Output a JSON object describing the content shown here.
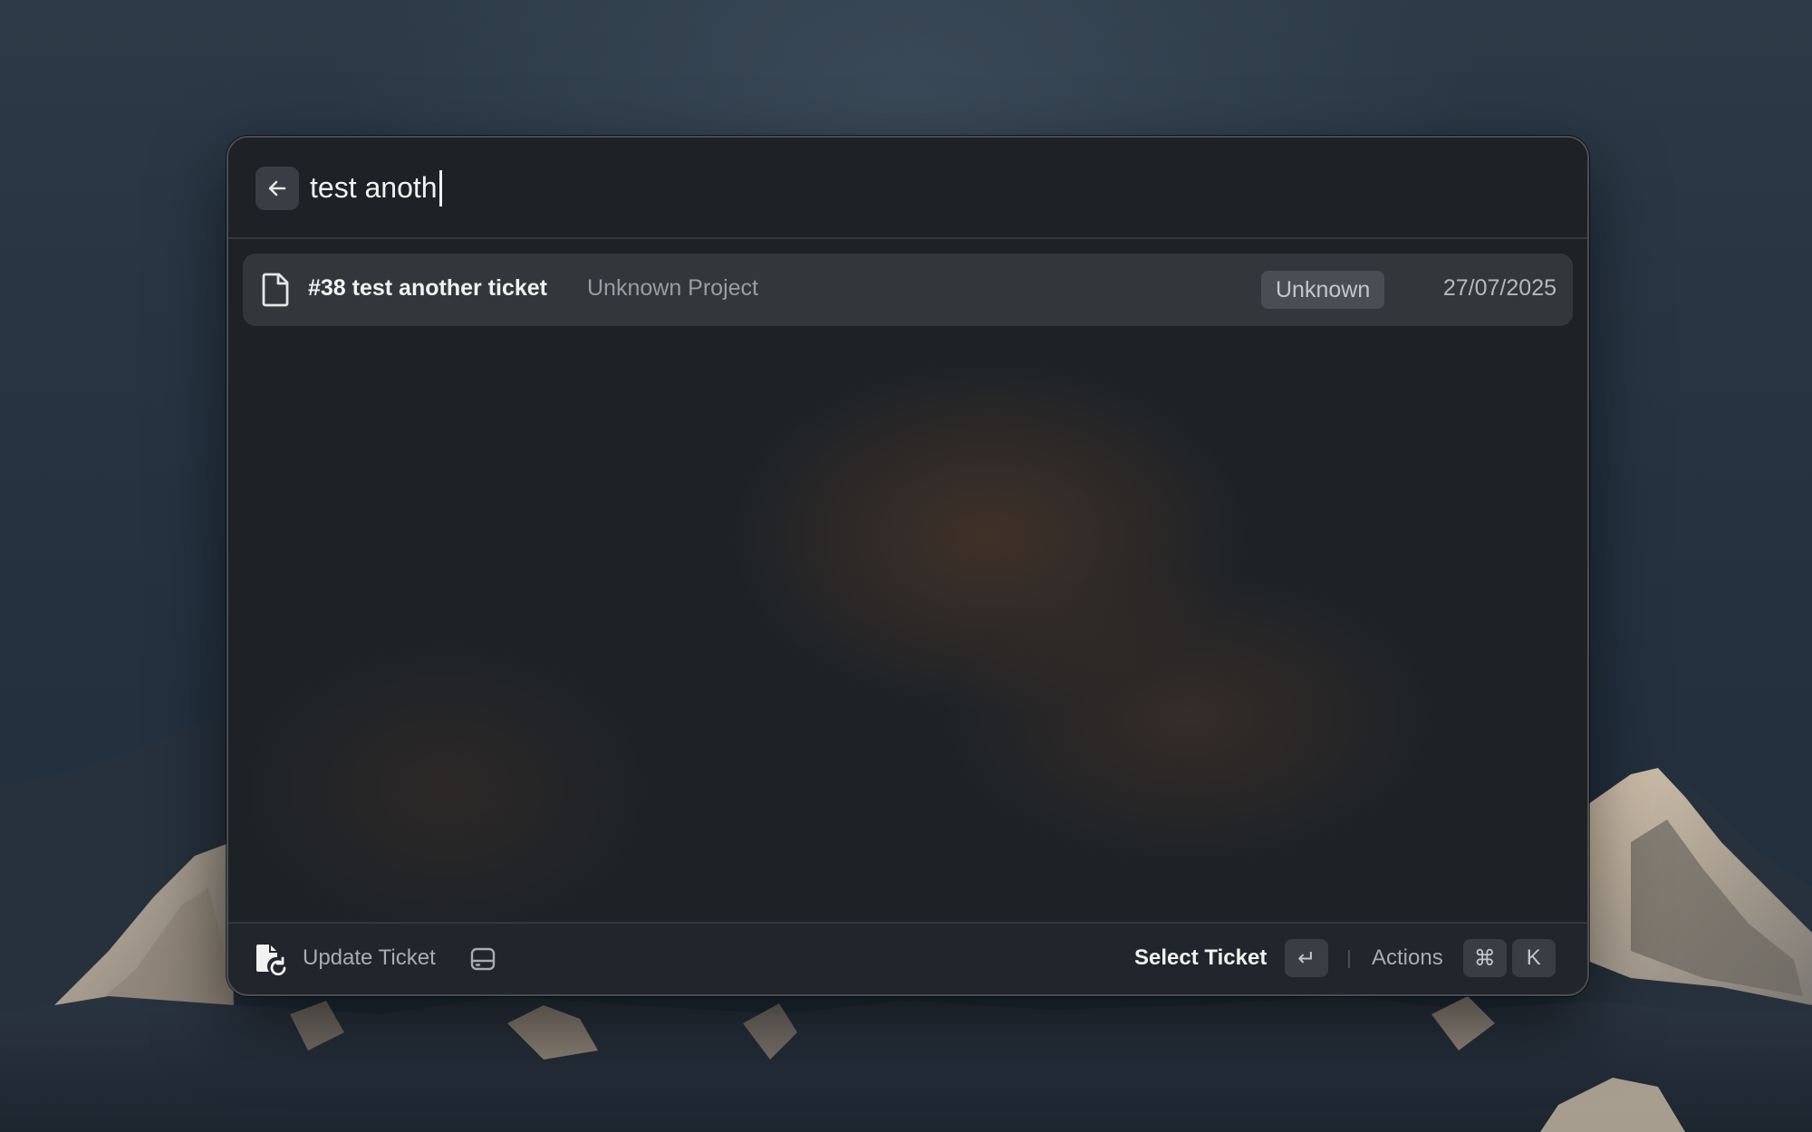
{
  "search": {
    "query": "test anoth",
    "back_icon": "arrow-left-icon"
  },
  "results": [
    {
      "icon": "document-icon",
      "title": "#38 test another ticket",
      "subtitle": "Unknown Project",
      "badge": "Unknown",
      "date": "27/07/2025",
      "selected": true
    }
  ],
  "footer": {
    "command_icon": "document-refresh-icon",
    "command_title": "Update Ticket",
    "tray_icon": "tray-icon",
    "primary_action_label": "Select Ticket",
    "primary_action_key": "↵",
    "secondary_action_label": "Actions",
    "secondary_action_keys": [
      "⌘",
      "K"
    ]
  },
  "colors": {
    "window_bg": "#1e2227",
    "selected_row_bg": "#33373c",
    "badge_bg": "#4a4e54",
    "text_primary": "#f2f2f2",
    "text_secondary": "#9a9da2"
  }
}
